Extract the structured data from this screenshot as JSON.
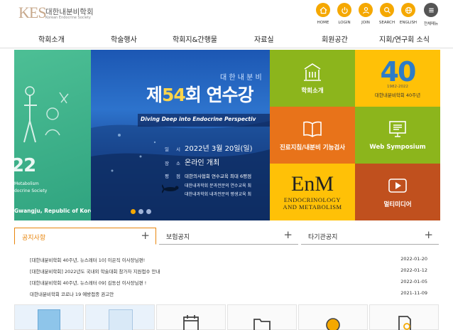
{
  "header": {
    "logo_mark": "KES",
    "logo_ko": "대한내분비학회",
    "logo_en": "Korean Endocrine Society",
    "quick_links": [
      {
        "label": "HOME",
        "icon": "home-icon"
      },
      {
        "label": "LOGIN",
        "icon": "power-icon"
      },
      {
        "label": "JOIN",
        "icon": "user-icon"
      },
      {
        "label": "SEARCH",
        "icon": "search-icon"
      },
      {
        "label": "ENGLISH",
        "icon": "globe-icon"
      },
      {
        "label": "전체메뉴",
        "icon": "menu-icon"
      }
    ],
    "accent": "#f5a800"
  },
  "nav": [
    "학회소개",
    "학술행사",
    "학회지&간행물",
    "자료실",
    "회원공간",
    "지회/연구회 소식"
  ],
  "hero": {
    "left": {
      "big": "22",
      "line1": "Metabolism",
      "line2": "docrine Society",
      "location": "Gwangju, Republic of Korea"
    },
    "main": {
      "sub": "대 한 내 분 비",
      "title_prefix": "제",
      "title_num": "54",
      "title_suffix": "회 연수강",
      "tagline": "Diving Deep into Endocrine Perspectiv",
      "date_label": "일 시",
      "date_value": "2022년 3월 20일(일)",
      "place_label": "장 소",
      "place_value": "온라인 개최",
      "points_label": "평 점",
      "point1": "대한의사협회 연수교육 최대 6평점",
      "point2": "대한내과학회 분과전문의 연수교육 최",
      "point3": "대한내과학회 내과전문의 평생교육 최"
    },
    "active_slide": 1,
    "slide_count": 3
  },
  "tiles": [
    {
      "label": "학회소개",
      "icon": "building-icon",
      "color": "#8cb51c"
    },
    {
      "label": "",
      "icon": "anniversary-logo",
      "color": "#ffc107",
      "mark": "40",
      "range": "1982-2022",
      "caption": "대한내분비학회 40주년"
    },
    {
      "label": "진료지침/내분비 기능검사",
      "icon": "book-icon",
      "color": "#e8731a"
    },
    {
      "label": "Web Symposium",
      "icon": "monitor-icon",
      "color": "#8cb51c"
    },
    {
      "label": "",
      "icon": "enm-logo",
      "color": "#ffc107",
      "mark": "EnM",
      "sub1": "ENDOCRINOLOGY",
      "sub2": "AND METABOLISM"
    },
    {
      "label": "멀티미디어",
      "icon": "play-icon",
      "color": "#c0501e"
    }
  ],
  "notice_tabs": [
    {
      "label": "공지사항",
      "active": true
    },
    {
      "label": "보험공지",
      "active": false
    },
    {
      "label": "타기관공지",
      "active": false
    }
  ],
  "notices": [
    {
      "title": "[대한내분비학회 40주년, 뉴스레터 10] 이은직 이사장님편!",
      "date": "2022-01-20"
    },
    {
      "title": "[대한내분비학회] 2022년도 국내외 학술대회 참가자 지원접수 안내",
      "date": "2022-01-12"
    },
    {
      "title": "[대한내분비학회 40주년, 뉴스레터 09] 김동선 이사장님편 !",
      "date": "2022-01-05"
    },
    {
      "title": "대한내분비학회 코로나 19 예방접종 권고안",
      "date": "2021-11-09"
    }
  ]
}
